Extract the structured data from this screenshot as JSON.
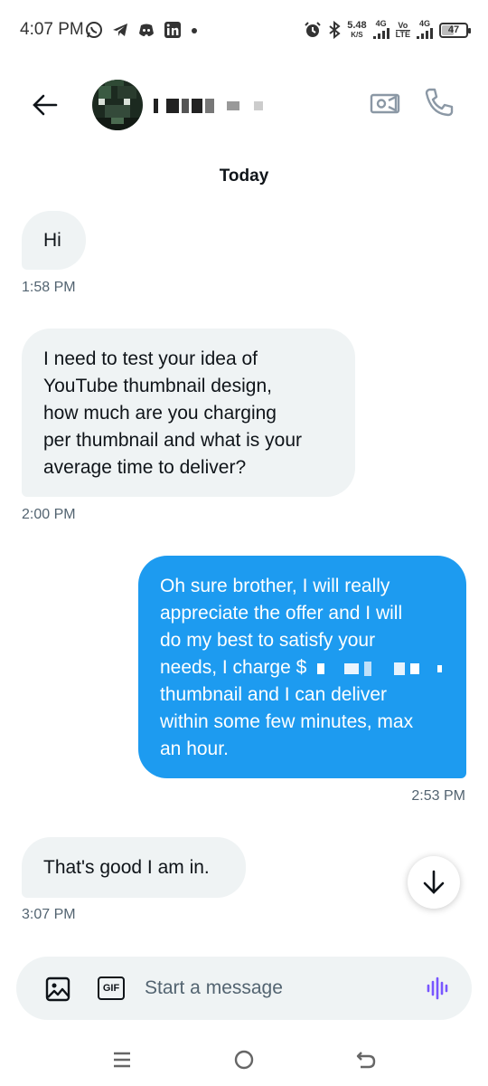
{
  "status_bar": {
    "time": "4:07 PM",
    "net_speed_value": "5.48",
    "net_speed_unit": "K/S",
    "signal1_label": "4G",
    "volte_top": "Vo",
    "volte_bottom": "LTE",
    "signal2_label": "4G",
    "battery": "47",
    "battery_level": 0.47,
    "notification_icons": [
      "whatsapp-icon",
      "telegram-icon",
      "discord-icon",
      "linkedin-icon",
      "dot-icon"
    ],
    "system_icons": [
      "alarm-icon",
      "bluetooth-icon"
    ]
  },
  "header": {
    "contact_name": "",
    "icons": {
      "back": "arrow-left-icon",
      "video": "video-call-icon",
      "call": "phone-icon"
    }
  },
  "conversation": {
    "day_label": "Today",
    "messages": [
      {
        "direction": "received",
        "text": "Hi",
        "time": "1:58 PM"
      },
      {
        "direction": "received",
        "lines": [
          "I need to test your idea of",
          "YouTube thumbnail design,",
          "how much are you charging",
          "per thumbnail and what is your",
          "average time to deliver?"
        ],
        "time": "2:00 PM"
      },
      {
        "direction": "sent",
        "lines": [
          "Oh sure brother, I will really",
          "appreciate the offer and I will",
          "do my best to satisfy your",
          "needs, I charge $",
          "thumbnail and I can deliver",
          "within some few minutes, max",
          "an hour."
        ],
        "time": "2:53 PM"
      },
      {
        "direction": "received",
        "text": "That's good I am in.",
        "time": "3:07 PM"
      }
    ]
  },
  "composer": {
    "placeholder": "Start a message",
    "gif_label": "GIF",
    "accent_color": "#7856ff"
  },
  "colors": {
    "sent_bubble": "#1d9bf0",
    "received_bubble": "#eff3f4",
    "timestamp": "#536471"
  }
}
